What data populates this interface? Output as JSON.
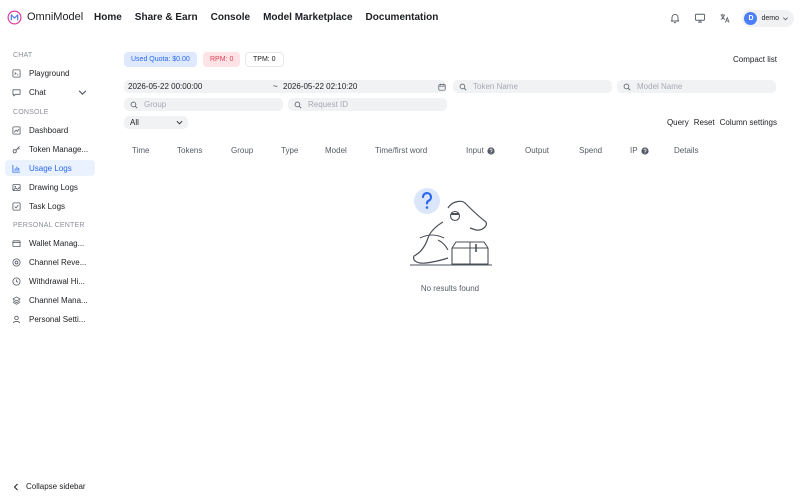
{
  "app": {
    "name": "OmniModel",
    "brand_color": "#e0409a"
  },
  "topnav": [
    "Home",
    "Share & Earn",
    "Console",
    "Model Marketplace",
    "Documentation"
  ],
  "top_icons": [
    "bell-icon",
    "monitor-icon",
    "translate-icon"
  ],
  "user": {
    "initial": "D",
    "name": "demo"
  },
  "sidebar": {
    "chat_title": "CHAT",
    "chat_items": [
      {
        "label": "Playground",
        "icon": "playground-icon"
      },
      {
        "label": "Chat",
        "icon": "chat-icon"
      }
    ],
    "console_title": "CONSOLE",
    "console_items": [
      {
        "label": "Dashboard",
        "icon": "dashboard-icon"
      },
      {
        "label": "Token Manage...",
        "icon": "key-icon"
      },
      {
        "label": "Usage Logs",
        "icon": "bar-chart-icon",
        "active": true
      },
      {
        "label": "Drawing Logs",
        "icon": "image-icon"
      },
      {
        "label": "Task Logs",
        "icon": "checkbox-icon"
      }
    ],
    "personal_title": "PERSONAL CENTER",
    "personal_items": [
      {
        "label": "Wallet Manag...",
        "icon": "wallet-icon"
      },
      {
        "label": "Channel Reve...",
        "icon": "coin-icon"
      },
      {
        "label": "Withdrawal Hi...",
        "icon": "clock-icon"
      },
      {
        "label": "Channel Mana...",
        "icon": "layers-icon"
      },
      {
        "label": "Personal Setti...",
        "icon": "user-icon"
      }
    ],
    "collapse_label": "Collapse sidebar"
  },
  "stats": {
    "quota": "Used Quota: $0.00",
    "rpm": "RPM: 0",
    "tpm": "TPM: 0"
  },
  "compact_label": "Compact list",
  "filters": {
    "start_date": "2026-05-22 00:00:00",
    "separator": "~",
    "end_date": "2026-05-22 02:10:20",
    "token_placeholder": "Token Name",
    "model_placeholder": "Model Name",
    "group_placeholder": "Group",
    "request_placeholder": "Request ID",
    "log_type": "All"
  },
  "actions": {
    "query": "Query",
    "reset": "Reset",
    "columns": "Column settings"
  },
  "table": {
    "columns": [
      "Time",
      "Tokens",
      "Group",
      "Type",
      "Model",
      "Time/first word",
      "Input",
      "Output",
      "Spend",
      "IP",
      "Details"
    ]
  },
  "empty_text": "No results found",
  "colors": {
    "accent": "#2a68f0",
    "active_bg": "#eaf1ff",
    "quota_bg": "#dfe9fd",
    "rpm_bg": "#fde3e6",
    "rpm_text": "#e0405a"
  }
}
